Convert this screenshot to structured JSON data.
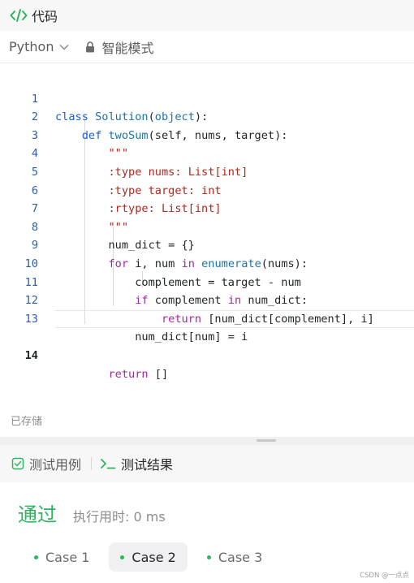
{
  "header": {
    "title": "代码",
    "icon": "code-icon"
  },
  "toolbar": {
    "language": "Python",
    "mode_label": "智能模式"
  },
  "editor": {
    "line_numbers": [
      "1",
      "2",
      "3",
      "4",
      "5",
      "6",
      "7",
      "8",
      "9",
      "10",
      "11",
      "12",
      "13",
      "14"
    ],
    "active_line": 14
  },
  "footer": {
    "saved_label": "已存储"
  },
  "tabs": {
    "testcase_label": "测试用例",
    "result_label": "测试结果"
  },
  "result": {
    "status": "通过",
    "runtime": "执行用时: 0 ms",
    "cases": [
      "Case 1",
      "Case 2",
      "Case 3"
    ],
    "selected_case": "Case 2"
  },
  "watermark": "CSDN @一点点",
  "colors": {
    "accent_green": "#2db55d",
    "keyword_blue": "#1a5fd1",
    "keyword_purple": "#a626a4",
    "string_red": "#b3261e"
  }
}
